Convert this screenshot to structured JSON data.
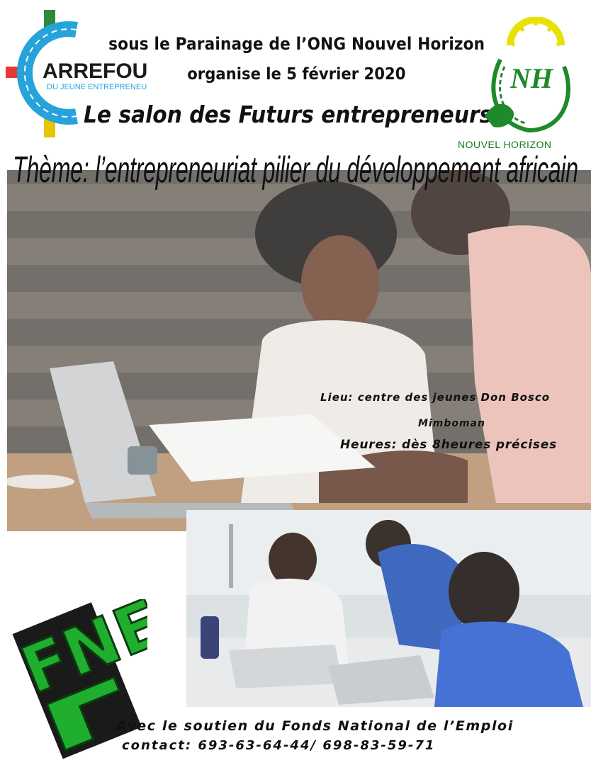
{
  "header": {
    "line1": "sous le Parainage de l’ONG Nouvel Horizon",
    "line2": "organise le 5 février 2020",
    "title": "Le salon des Futurs entrepreneurs",
    "theme": "Thème: l’entrepreneuriat pilier du développement africain"
  },
  "logos": {
    "carrefour": {
      "name": "ARREFOUR",
      "subtitle": "DU JEUNE ENTREPRENEUR",
      "color": "#27a3dc"
    },
    "nouvel_horizon": {
      "monogram": "NH",
      "caption": "NOUVEL HORIZON",
      "color": "#1e8a2a"
    },
    "fne": {
      "letters": "FNE",
      "color": "#1fae2e"
    }
  },
  "event": {
    "lieu": "Lieu: centre des jeunes  Don Bosco",
    "lieu_line2": "Mimboman",
    "heures": "Heures: dès 8heures précises"
  },
  "footer": {
    "support": "Avec le soutien du Fonds National de l’Emploi",
    "contact": "contact: 693-63-64-44/ 698-83-59-71"
  }
}
